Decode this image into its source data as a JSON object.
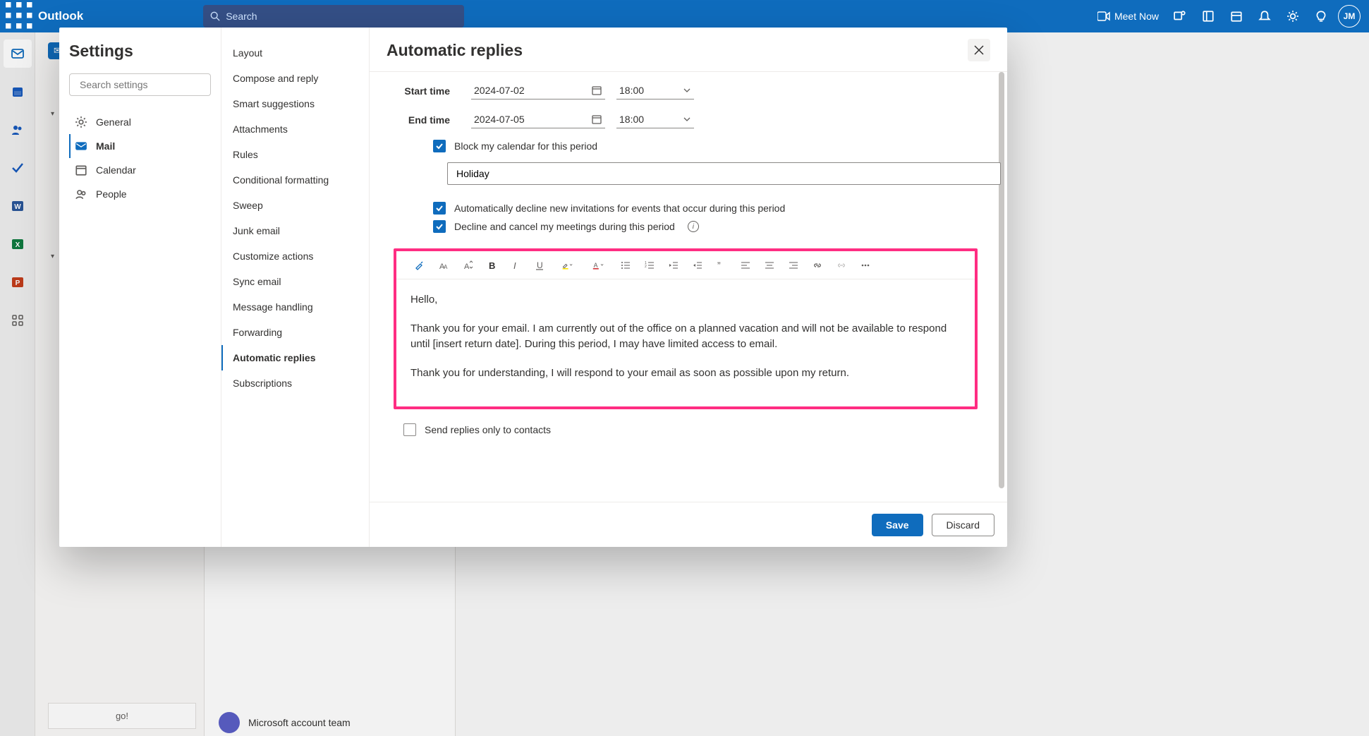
{
  "topbar": {
    "brand": "Outlook",
    "search_placeholder": "Search",
    "meet_now": "Meet Now",
    "avatar_initials": "JM"
  },
  "background": {
    "stay_connected": "go!",
    "ms_team": "Microsoft account team"
  },
  "dialog": {
    "title": "Settings",
    "search_placeholder": "Search settings",
    "nav1": [
      {
        "icon": "gear",
        "label": "General"
      },
      {
        "icon": "mail",
        "label": "Mail"
      },
      {
        "icon": "calendar",
        "label": "Calendar"
      },
      {
        "icon": "people",
        "label": "People"
      }
    ],
    "nav2": [
      "Layout",
      "Compose and reply",
      "Smart suggestions",
      "Attachments",
      "Rules",
      "Conditional formatting",
      "Sweep",
      "Junk email",
      "Customize actions",
      "Sync email",
      "Message handling",
      "Forwarding",
      "Automatic replies",
      "Subscriptions"
    ],
    "nav2_selected": 12,
    "panel": {
      "title": "Automatic replies",
      "start_label": "Start time",
      "end_label": "End time",
      "start_date": "2024-07-02",
      "start_time": "18:00",
      "end_date": "2024-07-05",
      "end_time": "18:00",
      "block_label": "Block my calendar for this period",
      "block_title_value": "Holiday",
      "decline_label": "Automatically decline new invitations for events that occur during this period",
      "cancel_label": "Decline and cancel my meetings during this period",
      "body_p1": "Hello,",
      "body_p2": "Thank you for your email. I am currently out of the office on a planned vacation and will not be available to respond until [insert return date]. During this period, I may have limited access to email.",
      "body_p3": "Thank you for understanding, I will respond to your email as soon as possible upon my return.",
      "contacts_only_label": "Send replies only to contacts",
      "save": "Save",
      "discard": "Discard"
    }
  }
}
